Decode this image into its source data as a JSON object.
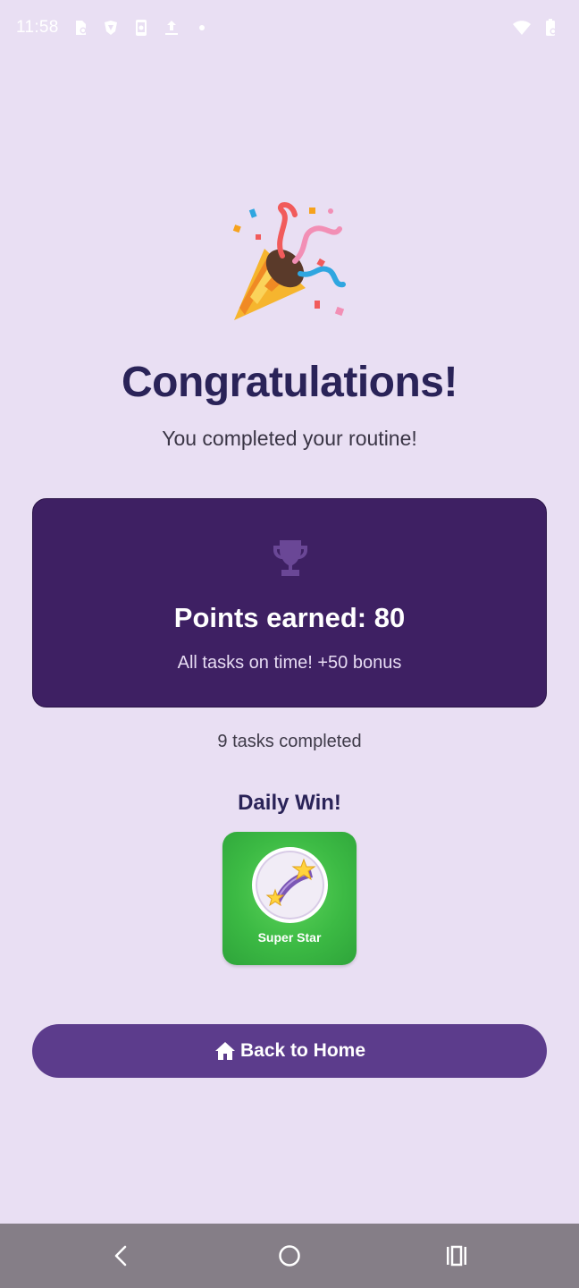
{
  "status_bar": {
    "time": "11:58",
    "left_icons": [
      "battery-saver-icon",
      "shield-app-icon",
      "phone-sync-icon",
      "upload-icon",
      "dot-icon"
    ],
    "right_icons": [
      "wifi-icon",
      "battery-icon"
    ]
  },
  "celebration": {
    "icon": "party-popper-icon",
    "title": "Congratulations!",
    "subtitle": "You completed your routine!"
  },
  "points_card": {
    "icon": "trophy-icon",
    "points_text": "Points earned: 80",
    "bonus_text": "All tasks on time! +50 bonus"
  },
  "tasks_completed": "9 tasks completed",
  "daily_win": {
    "heading": "Daily Win!",
    "badge_icon": "shooting-star-icon",
    "badge_label": "Super Star"
  },
  "home_button": {
    "icon": "home-icon",
    "label": "Back to Home"
  },
  "nav_bar": {
    "buttons": [
      "back-icon",
      "home-circle-icon",
      "recents-icon"
    ]
  },
  "colors": {
    "background": "#e9dff3",
    "title": "#2a2358",
    "card": "#3e2063",
    "button": "#5c3c8c",
    "badge_green": "#3cba44",
    "nav_bar": "#857e87"
  }
}
